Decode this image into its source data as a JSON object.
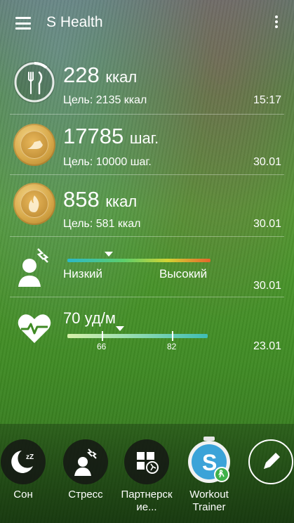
{
  "app": {
    "title": "S Health"
  },
  "food": {
    "value": "228",
    "unit": "ккал",
    "goal": "Цель: 2135 ккал",
    "time": "15:17",
    "progress": 0.107
  },
  "steps": {
    "value": "17785",
    "unit": "шаг.",
    "goal": "Цель: 10000 шаг.",
    "time": "30.01"
  },
  "exercise": {
    "value": "858",
    "unit": "ккал",
    "goal": "Цель: 581 ккал",
    "time": "30.01"
  },
  "stress": {
    "low_label": "Низкий",
    "high_label": "Высокий",
    "time": "30.01",
    "level": 0.29
  },
  "heart": {
    "value": "70",
    "unit": "уд/м",
    "tick_low": "66",
    "tick_high": "82",
    "time": "23.01",
    "range_min": 66,
    "range_max": 82
  },
  "shortcuts": [
    {
      "label": "Сон",
      "icon": "sleep-icon"
    },
    {
      "label": "Стресс",
      "icon": "stress-icon"
    },
    {
      "label": "Партнерск ие...",
      "icon": "partner-apps-icon"
    },
    {
      "label": "Workout Trainer",
      "icon": "workout-trainer-icon"
    },
    {
      "label": "",
      "icon": "edit-icon"
    }
  ],
  "colors": {
    "accent_green": "#3fb14a",
    "workout_blue": "#3ba3d8",
    "medal_gold": "#d8a94a"
  }
}
